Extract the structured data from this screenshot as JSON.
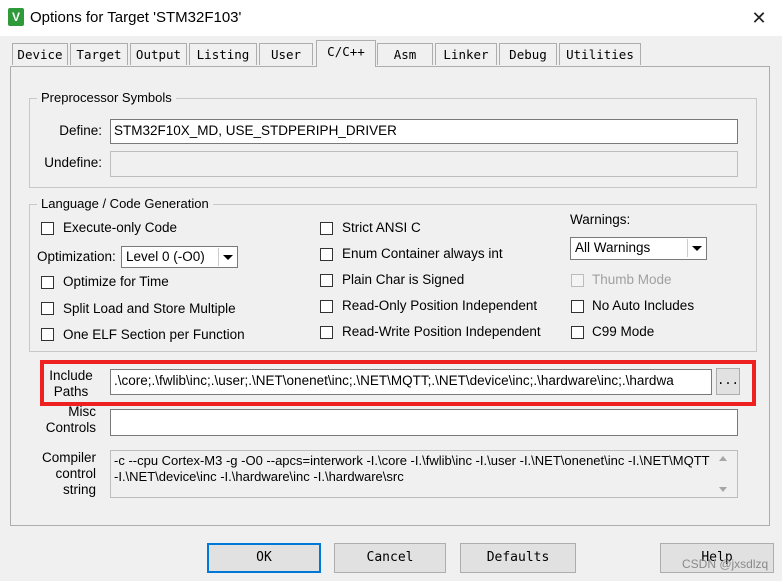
{
  "window": {
    "title": "Options for Target 'STM32F103'",
    "app_icon": "keil-uvision-icon",
    "close_glyph": "✕"
  },
  "tabs": [
    "Device",
    "Target",
    "Output",
    "Listing",
    "User",
    "C/C++",
    "Asm",
    "Linker",
    "Debug",
    "Utilities"
  ],
  "active_tab": "C/C++",
  "preprocessor": {
    "legend": "Preprocessor Symbols",
    "define_label": "Define:",
    "define_value": "STM32F10X_MD, USE_STDPERIPH_DRIVER",
    "undefine_label": "Undefine:",
    "undefine_value": ""
  },
  "language": {
    "legend": "Language / Code Generation",
    "execute_only": {
      "label": "Execute-only Code",
      "checked": false
    },
    "optimization_label": "Optimization:",
    "optimization_value": "Level 0 (-O0)",
    "optimize_time": {
      "label": "Optimize for Time",
      "checked": false
    },
    "split_load": {
      "label": "Split Load and Store Multiple",
      "checked": false
    },
    "one_elf": {
      "label": "One ELF Section per Function",
      "checked": false
    },
    "strict_ansi": {
      "label": "Strict ANSI C",
      "checked": false
    },
    "enum_int": {
      "label": "Enum Container always int",
      "checked": false
    },
    "plain_char": {
      "label": "Plain Char is Signed",
      "checked": false
    },
    "ro_pi": {
      "label": "Read-Only Position Independent",
      "checked": false
    },
    "rw_pi": {
      "label": "Read-Write Position Independent",
      "checked": false
    },
    "warnings_label": "Warnings:",
    "warnings_value": "All Warnings",
    "thumb_mode": {
      "label": "Thumb Mode",
      "checked": false,
      "enabled": false
    },
    "no_auto_includes": {
      "label": "No Auto Includes",
      "checked": false
    },
    "c99_mode": {
      "label": "C99 Mode",
      "checked": false
    }
  },
  "include_paths": {
    "label_line1": "Include",
    "label_line2": "Paths",
    "value": ".\\core;.\\fwlib\\inc;.\\user;.\\NET\\onenet\\inc;.\\NET\\MQTT;.\\NET\\device\\inc;.\\hardware\\inc;.\\hardwa",
    "browse_label": "..."
  },
  "misc": {
    "label_line1": "Misc",
    "label_line2": "Controls",
    "value": ""
  },
  "compiler": {
    "label_line1": "Compiler",
    "label_line2": "control",
    "label_line3": "string",
    "value": "-c --cpu Cortex-M3 -g -O0 --apcs=interwork -I.\\core -I.\\fwlib\\inc -I.\\user -I.\\NET\\onenet\\inc -I.\\NET\\MQTT -I.\\NET\\device\\inc -I.\\hardware\\inc -I.\\hardware\\src"
  },
  "buttons": {
    "ok": "OK",
    "cancel": "Cancel",
    "defaults": "Defaults",
    "help": "Help"
  },
  "watermark": "CSDN @jxsdlzq",
  "colors": {
    "highlight": "#ee2020",
    "background": "#f0f0f0",
    "focus": "#0078d7"
  }
}
